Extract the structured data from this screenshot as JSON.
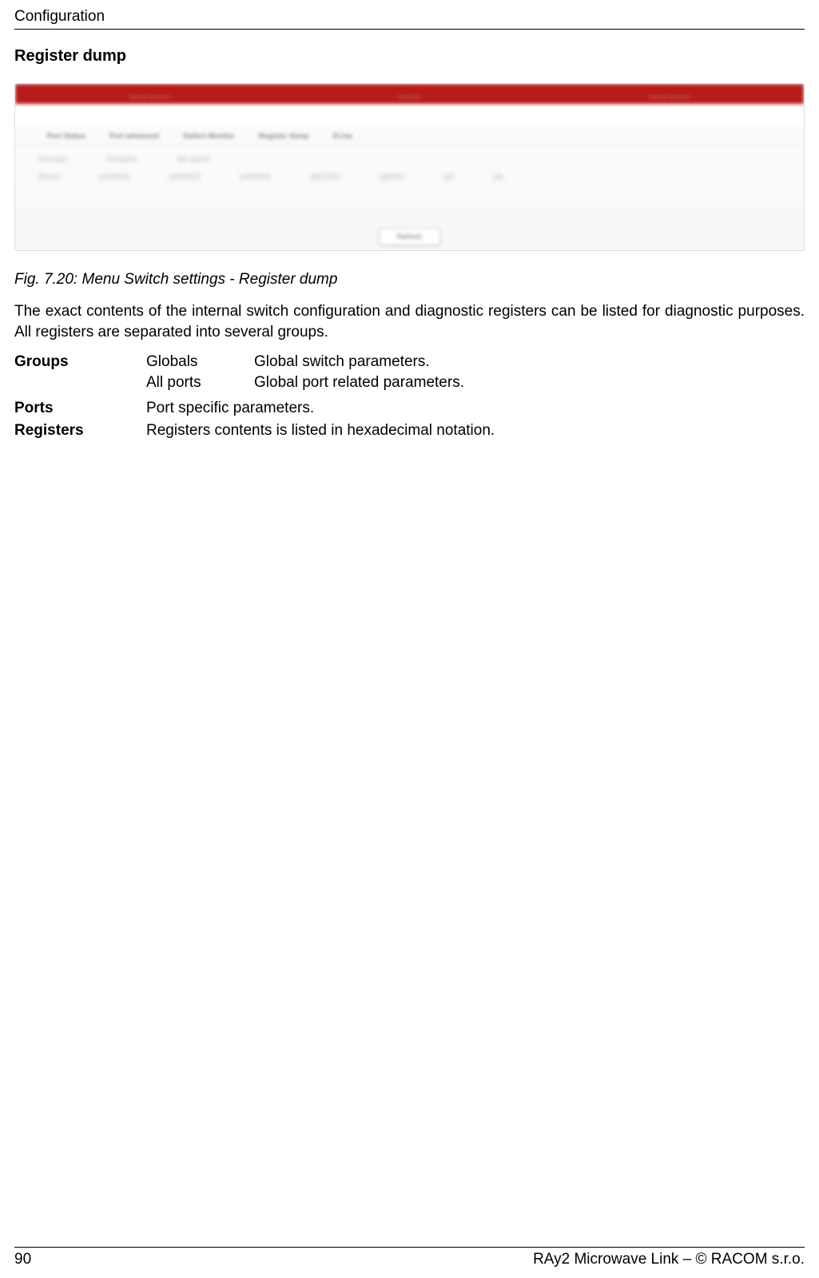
{
  "header": "Configuration",
  "section_title": "Register dump",
  "screenshot": {
    "tabs": [
      "Port Status",
      "Port advanced",
      "Switch Monitor",
      "Register dump",
      "ELine"
    ],
    "row1_label": "Groups",
    "row1_opts": [
      "Globals",
      "All ports"
    ],
    "row2_label": "Ports",
    "row2_opts": [
      "p2/Eth1",
      "p3/Eth2",
      "p4/Eth3",
      "p5/CPU",
      "p6/Air",
      "p5",
      "p6"
    ],
    "button": "Refresh"
  },
  "caption": "Fig. 7.20: Menu Switch settings - Register dump",
  "paragraph": "The exact contents of the internal switch configuration and diagnostic registers can be listed for diagnostic purposes. All registers are separated into several groups.",
  "defs": {
    "groups": {
      "label": "Groups",
      "items": [
        {
          "k": "Globals",
          "v": "Global switch parameters."
        },
        {
          "k": "All ports",
          "v": "Global port related parameters."
        }
      ]
    },
    "ports": {
      "label": "Ports",
      "text": "Port specific parameters."
    },
    "registers": {
      "label": "Registers",
      "text": "Registers contents is listed in hexadecimal notation."
    }
  },
  "footer": {
    "page": "90",
    "right": "RAy2 Microwave Link – © RACOM s.r.o."
  }
}
